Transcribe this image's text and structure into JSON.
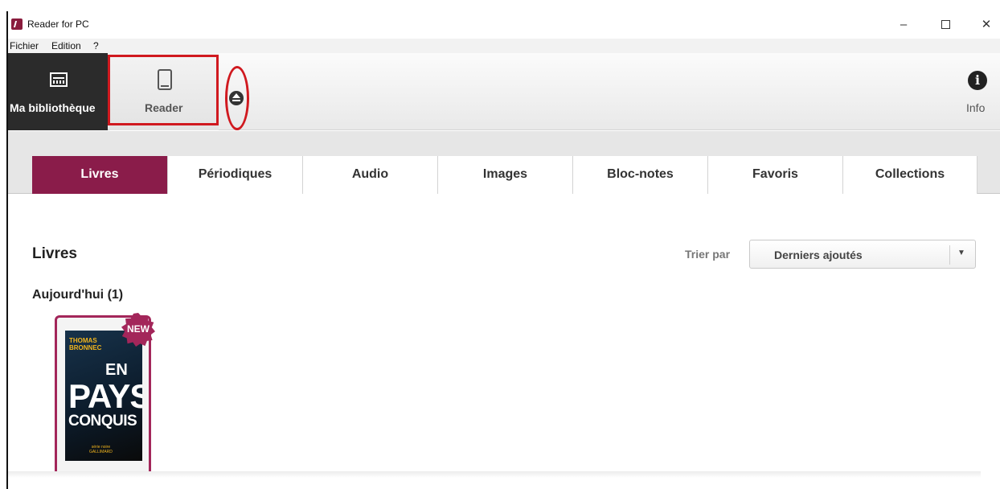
{
  "window": {
    "title": "Reader for PC"
  },
  "window_controls": {
    "minimize": "–",
    "close": "✕"
  },
  "menu": {
    "items": [
      "Fichier",
      "Edition",
      "?"
    ]
  },
  "toolbar": {
    "library_label": "Ma bibliothèque",
    "reader_label": "Reader",
    "info_label": "Info",
    "info_glyph": "i"
  },
  "tabs": [
    {
      "label": "Livres",
      "active": true
    },
    {
      "label": "Périodiques",
      "active": false
    },
    {
      "label": "Audio",
      "active": false
    },
    {
      "label": "Images",
      "active": false
    },
    {
      "label": "Bloc-notes",
      "active": false
    },
    {
      "label": "Favoris",
      "active": false
    },
    {
      "label": "Collections",
      "active": false
    }
  ],
  "content": {
    "section_title": "Livres",
    "sort_label": "Trier par",
    "sort_value": "Derniers ajoutés",
    "sort_arrow": "▼",
    "group_title": "Aujourd'hui (1)"
  },
  "book": {
    "badge": "NEW",
    "cover_author_line1": "THOMAS",
    "cover_author_line2": "BRONNEC",
    "cover_title_1": "EN",
    "cover_title_2": "PAYS",
    "cover_title_3": "CONQUIS",
    "cover_series": "série noire",
    "cover_publisher": "GALLIMARD"
  },
  "colors": {
    "accent": "#8a1c4a",
    "highlight": "#d0191f",
    "toolbar_dark": "#2b2b2b"
  }
}
